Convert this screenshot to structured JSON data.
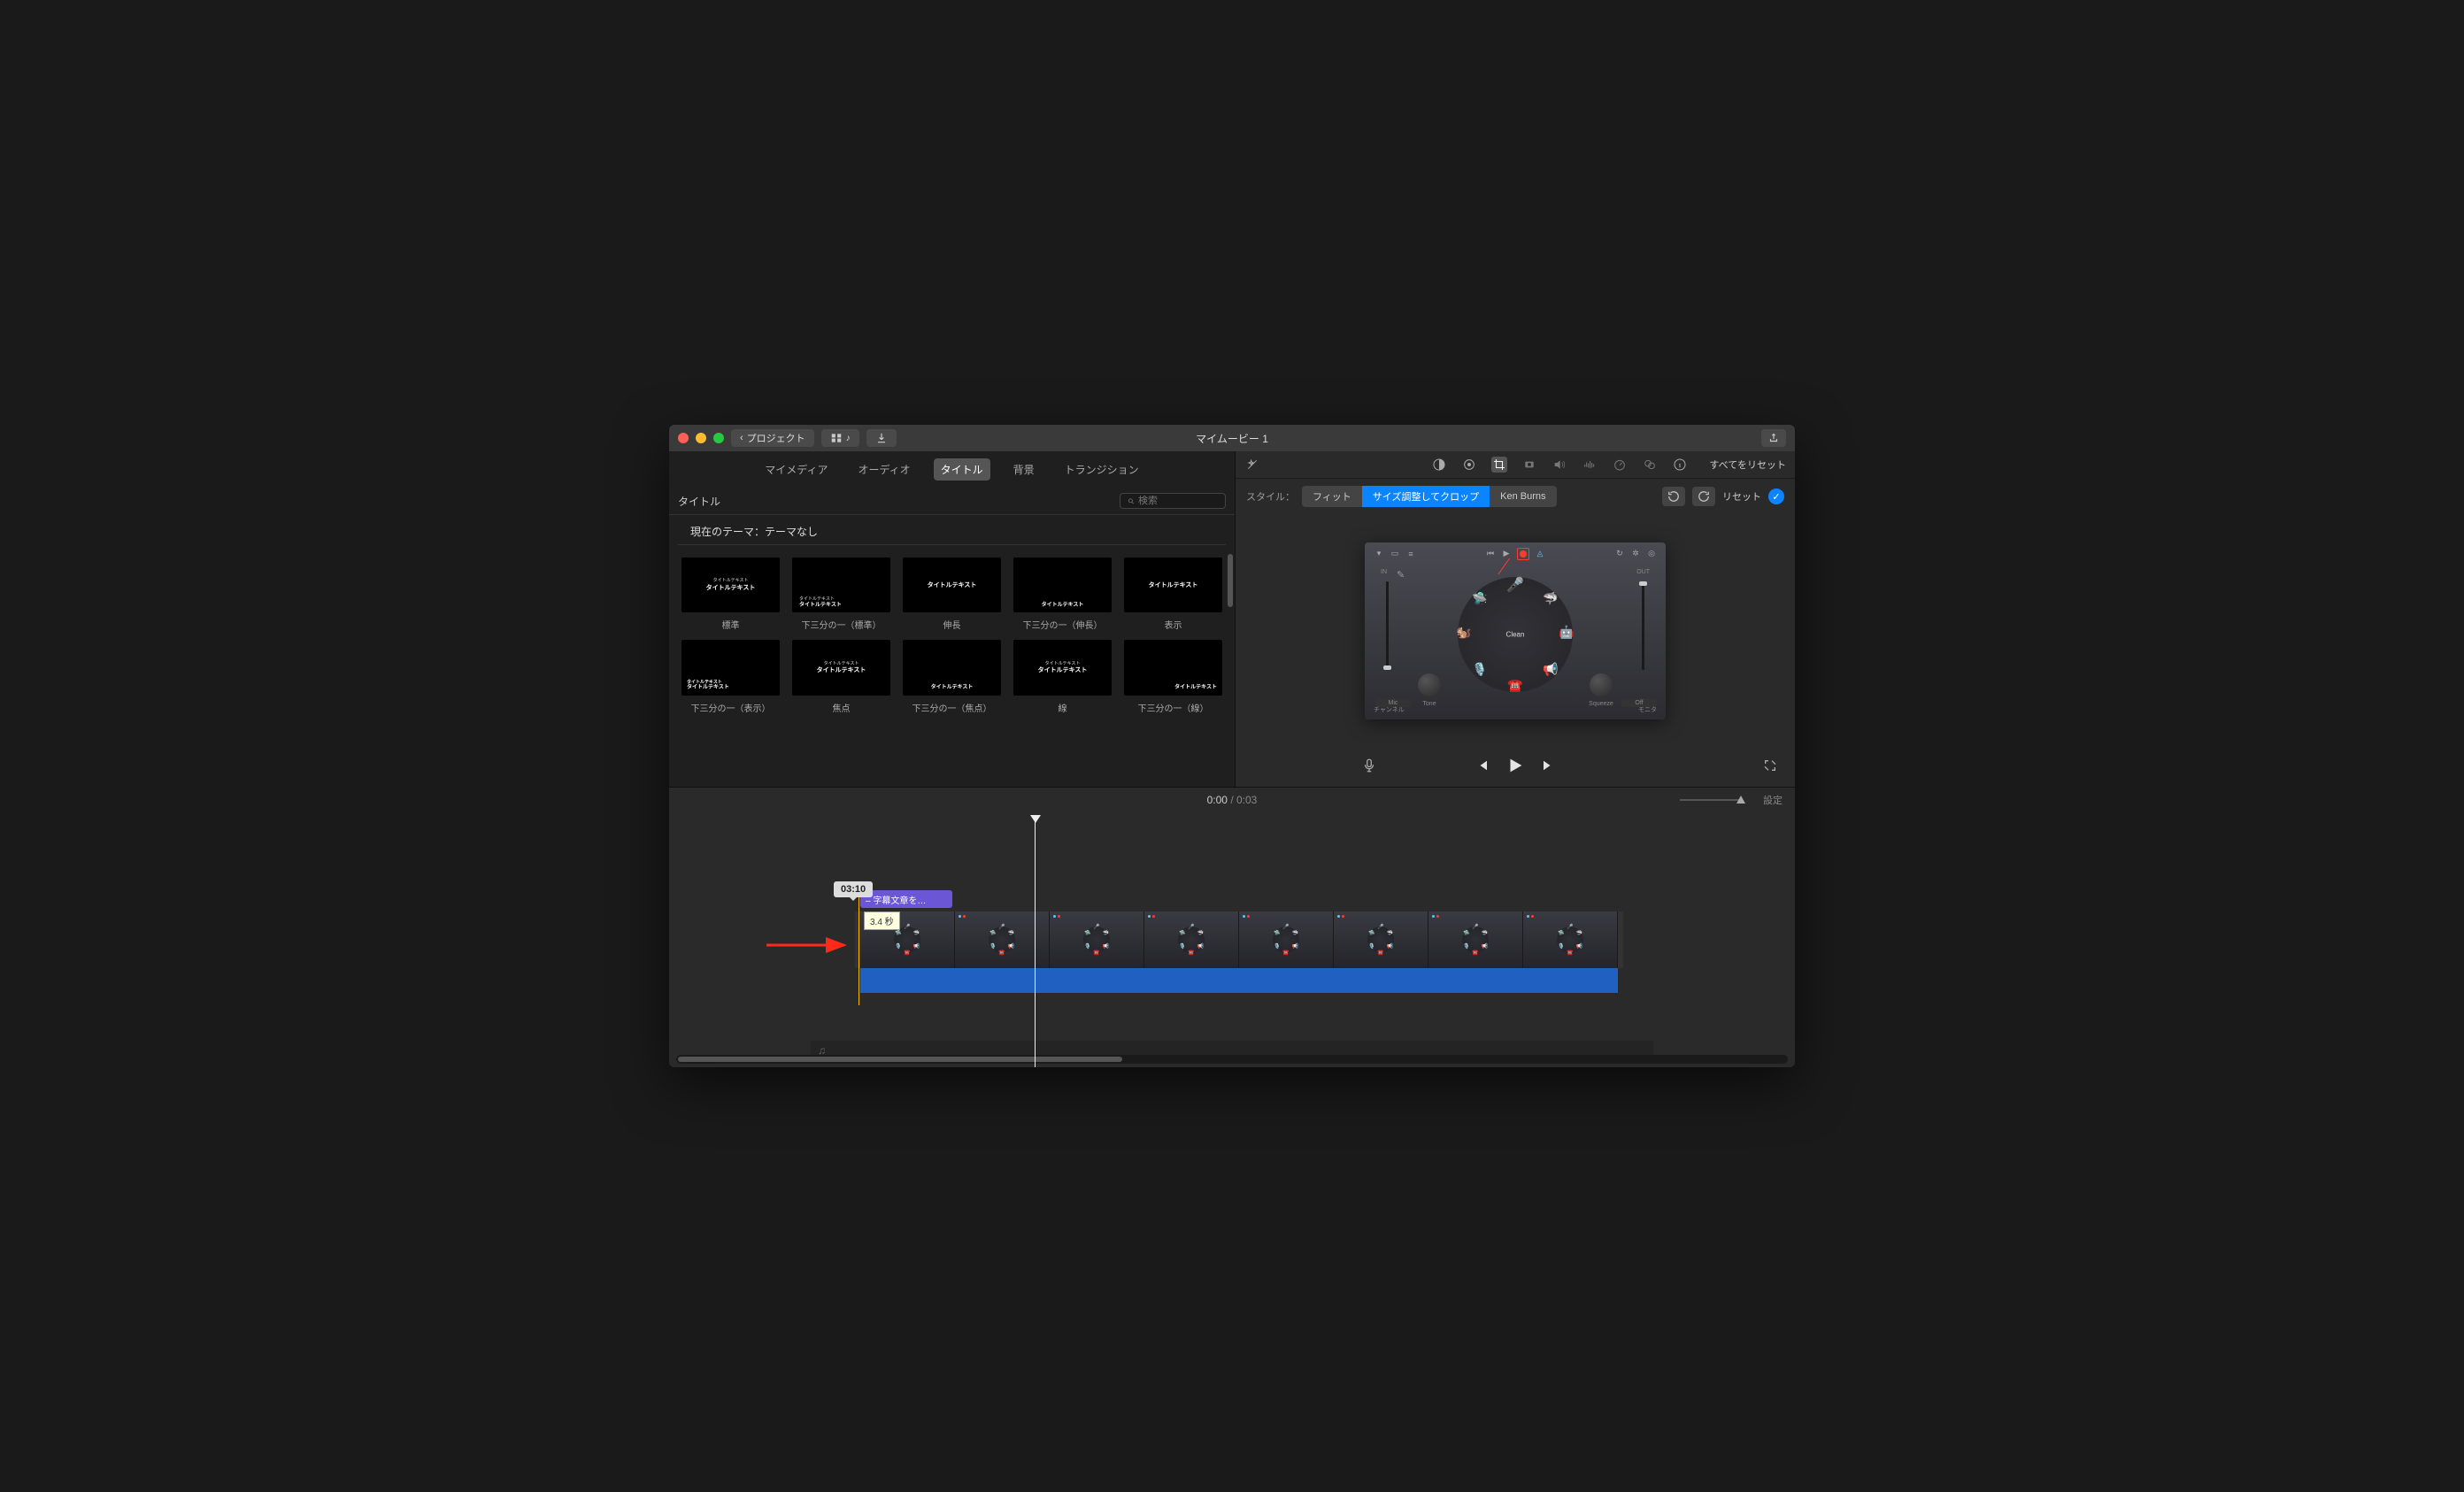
{
  "titlebar": {
    "back_label": "プロジェクト",
    "window_title": "マイムービー 1"
  },
  "media_tabs": {
    "my_media": "マイメディア",
    "audio": "オーディオ",
    "titles": "タイトル",
    "backgrounds": "背景",
    "transitions": "トランジション"
  },
  "browser": {
    "section_label": "タイトル",
    "search_placeholder": "検索",
    "theme_label": "現在のテーマ：テーマなし",
    "items": [
      {
        "name": "標準",
        "lines": [
          "タイトルテキスト",
          "タイトルテキスト"
        ]
      },
      {
        "name": "下三分の一（標準）",
        "lines": [
          "タイトルテキスト",
          "タイトルテキスト"
        ]
      },
      {
        "name": "伸長",
        "lines": [
          "タイトルテキスト"
        ]
      },
      {
        "name": "下三分の一（伸長）",
        "lines": [
          "タイトルテキスト"
        ]
      },
      {
        "name": "表示",
        "lines": [
          "タイトルテキスト"
        ]
      },
      {
        "name": "下三分の一（表示）",
        "lines": [
          "タイトルテキスト",
          "タイトルテキスト"
        ]
      },
      {
        "name": "焦点",
        "lines": [
          "タイトルテキスト",
          "タイトルテキスト"
        ]
      },
      {
        "name": "下三分の一（焦点）",
        "lines": [
          "タイトルテキスト"
        ]
      },
      {
        "name": "線",
        "lines": [
          "タイトルテキスト",
          "タイトルテキスト"
        ]
      },
      {
        "name": "下三分の一（線）",
        "lines": [
          "タイトルテキスト"
        ]
      }
    ]
  },
  "adjust": {
    "reset_all": "すべてをリセット"
  },
  "style": {
    "label": "スタイル：",
    "fit": "フィット",
    "crop": "サイズ調整してクロップ",
    "ken_burns": "Ken Burns",
    "reset": "リセット"
  },
  "preview": {
    "in_label": "IN",
    "out_label": "OUT",
    "center_label": "Clean",
    "tone_label": "Tone",
    "mic_label": "Mic",
    "squeeze_label": "Squeeze",
    "off_label": "Off",
    "channel_label": "チャンネル",
    "monitor_label": "モニタ"
  },
  "timecode": {
    "current": "0:00",
    "duration": "0:03"
  },
  "settings_label": "設定",
  "timeline": {
    "scrub_time": "03:10",
    "title_clip_label": "– 字幕文章を…",
    "tooltip": "3.4 秒"
  }
}
